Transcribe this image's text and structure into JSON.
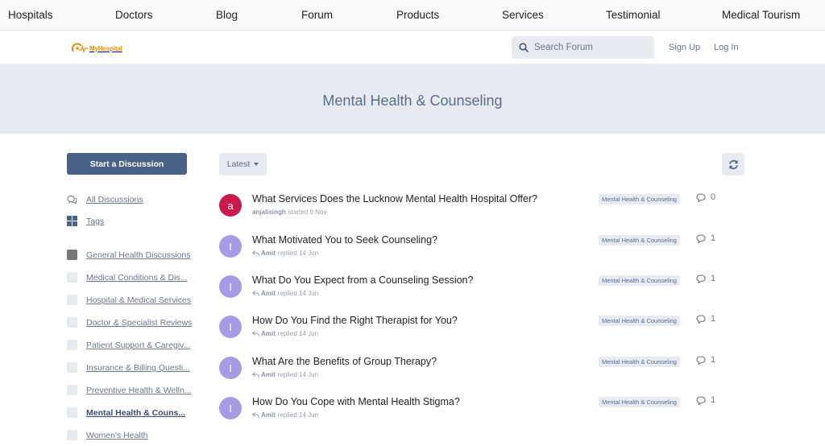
{
  "topnav": [
    "Hospitals",
    "Doctors",
    "Blog",
    "Forum",
    "Products",
    "Services",
    "Testimonial",
    "Medical Tourism"
  ],
  "header": {
    "logo_text": "MyHospital",
    "search_placeholder": "Search Forum",
    "signup": "Sign Up",
    "login": "Log In"
  },
  "hero": {
    "title": "Mental Health & Counseling"
  },
  "sidebar": {
    "start_button": "Start a Discussion",
    "nav": [
      {
        "label": "All Discussions",
        "icon": "comments-icon"
      },
      {
        "label": "Tags",
        "icon": "tags-grid-icon"
      }
    ],
    "tags": [
      {
        "label": "General Health Discussions",
        "active": false
      },
      {
        "label": "Medical Conditions & Dis...",
        "active": false
      },
      {
        "label": "Hospital & Medical Services",
        "active": false
      },
      {
        "label": "Doctor & Specialist Reviews",
        "active": false
      },
      {
        "label": "Patient Support & Caregiv...",
        "active": false
      },
      {
        "label": "Insurance & Billing Questi...",
        "active": false
      },
      {
        "label": "Preventive Health & Welln...",
        "active": false
      },
      {
        "label": "Mental Health & Couns...",
        "active": true
      },
      {
        "label": "Women's Health",
        "active": false
      }
    ]
  },
  "toolbar": {
    "sort_label": "Latest"
  },
  "discussions": [
    {
      "avatar": "a",
      "avatar_color": "#c91a4b",
      "title": "What Services Does the Lucknow Mental Health Hospital Offer?",
      "user": "anjalisingh",
      "action": "started 6 Nov",
      "tag": "Mental Health & Counseling",
      "replies": "0",
      "reply_arrow": false
    },
    {
      "avatar": "I",
      "avatar_color": "#a89be6",
      "title": "What Motivated You to Seek Counseling?",
      "user": "Amit",
      "action": "replied 14 Jun",
      "tag": "Mental Health & Counseling",
      "replies": "1",
      "reply_arrow": true
    },
    {
      "avatar": "I",
      "avatar_color": "#a89be6",
      "title": "What Do You Expect from a Counseling Session?",
      "user": "Amit",
      "action": "replied 14 Jun",
      "tag": "Mental Health & Counseling",
      "replies": "1",
      "reply_arrow": true
    },
    {
      "avatar": "I",
      "avatar_color": "#a89be6",
      "title": "How Do You Find the Right Therapist for You?",
      "user": "Amit",
      "action": "replied 14 Jun",
      "tag": "Mental Health & Counseling",
      "replies": "1",
      "reply_arrow": true
    },
    {
      "avatar": "I",
      "avatar_color": "#a89be6",
      "title": "What Are the Benefits of Group Therapy?",
      "user": "Amit",
      "action": "replied 14 Jun",
      "tag": "Mental Health & Counseling",
      "replies": "1",
      "reply_arrow": true
    },
    {
      "avatar": "I",
      "avatar_color": "#a89be6",
      "title": "How Do You Cope with Mental Health Stigma?",
      "user": "Amit",
      "action": "replied 14 Jun",
      "tag": "Mental Health & Counseling",
      "replies": "1",
      "reply_arrow": true
    }
  ],
  "colors": {
    "primary": "#4b6288",
    "hero_bg": "#e7ebf1",
    "logo": "#e8900c"
  }
}
